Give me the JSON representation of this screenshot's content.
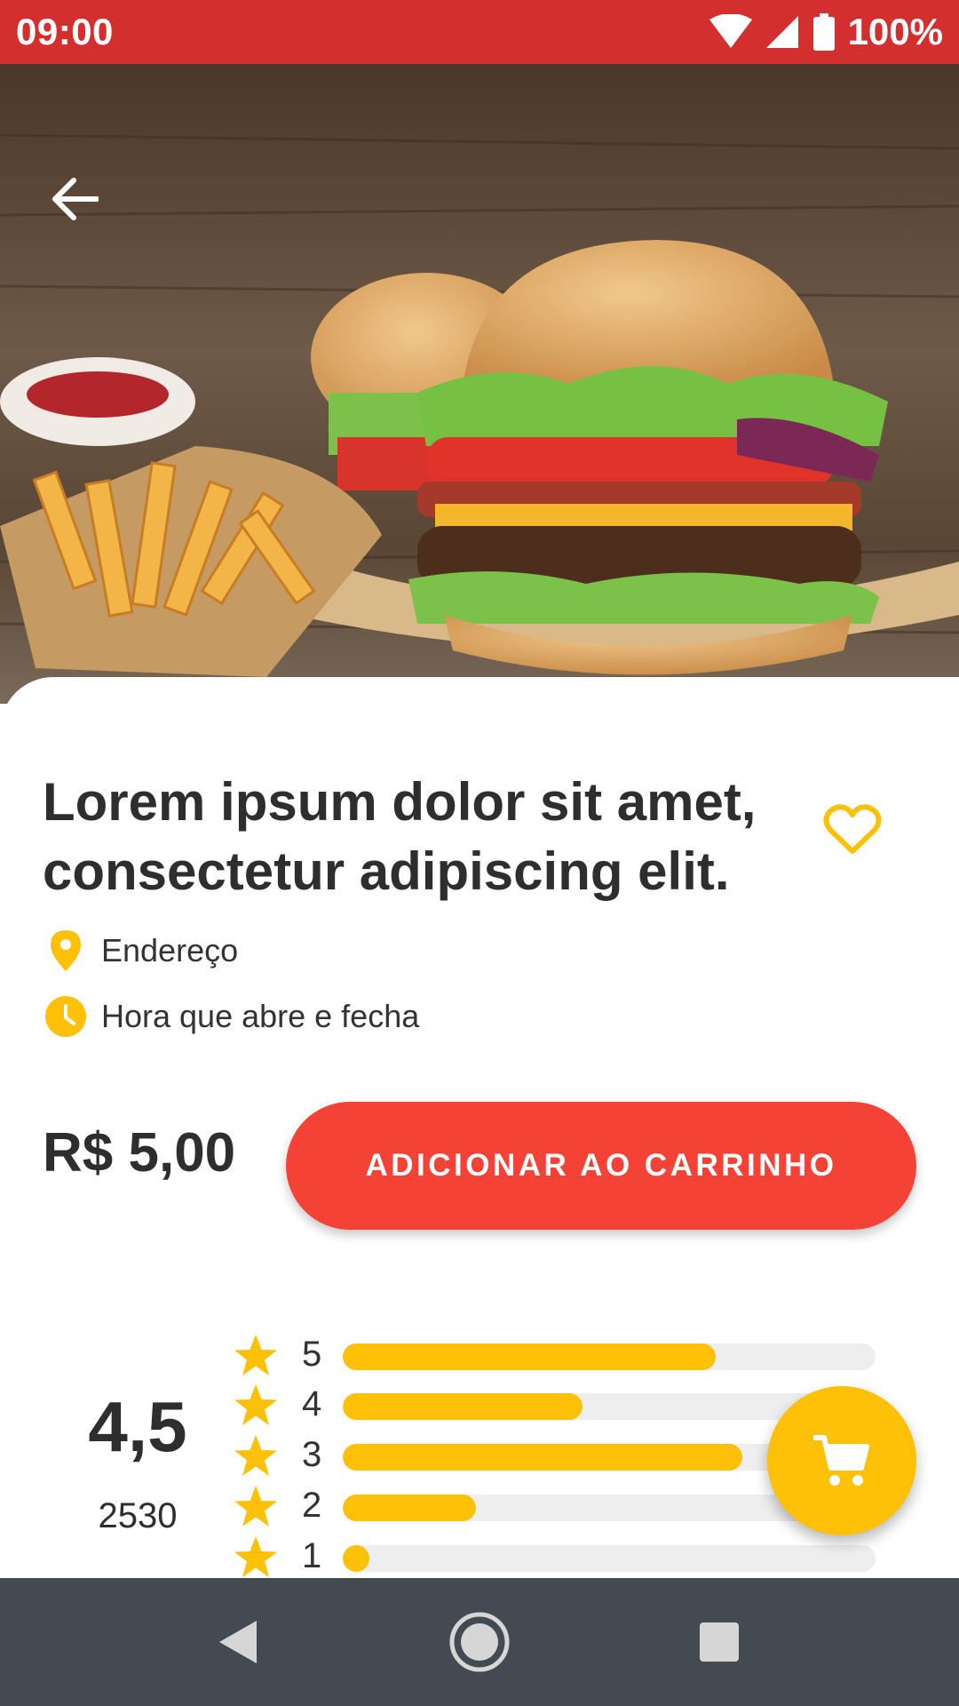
{
  "status_bar": {
    "time": "09:00",
    "battery": "100%",
    "icons": [
      "wifi-icon",
      "signal-icon",
      "battery-icon"
    ],
    "background": "#d32f2f"
  },
  "hero": {
    "image_subject": "burger and fries",
    "back_icon": "arrow-back-icon"
  },
  "product": {
    "title": "Lorem ipsum dolor sit amet, consectetur adipiscing elit.",
    "favorite_icon": "heart-outline-icon",
    "address": "Endereço",
    "address_icon": "location-pin-icon",
    "hours": "Hora que abre e fecha",
    "hours_icon": "clock-icon",
    "price": "R$ 5,00"
  },
  "actions": {
    "add_to_cart_label": "ADICIONAR AO CARRINHO",
    "add_to_cart_color": "#f44336",
    "cart_fab_icon": "cart-icon"
  },
  "rating": {
    "average": "4,5",
    "count": "2530",
    "accent": "#ffc107",
    "bars": [
      {
        "stars": "5",
        "fraction": 0.7
      },
      {
        "stars": "4",
        "fraction": 0.45
      },
      {
        "stars": "3",
        "fraction": 0.75
      },
      {
        "stars": "2",
        "fraction": 0.25
      },
      {
        "stars": "1",
        "fraction": 0.05
      }
    ]
  },
  "nav_bar": {
    "buttons": [
      "back-triangle-icon",
      "home-circle-icon",
      "recents-square-icon"
    ]
  }
}
